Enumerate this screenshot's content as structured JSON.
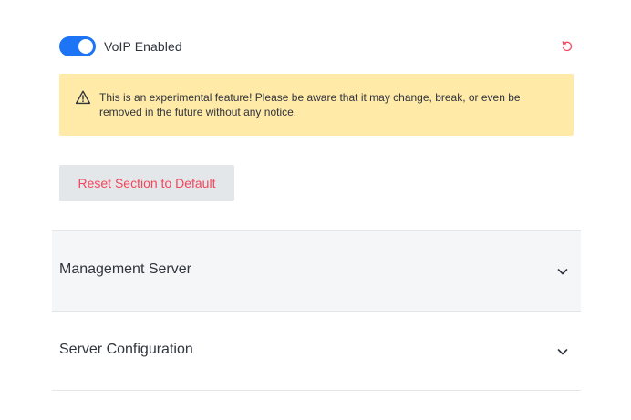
{
  "voip_toggle": {
    "label": "VoIP Enabled",
    "enabled": true,
    "accent_color": "#1d74f5",
    "reset_icon": "reset-icon"
  },
  "warning": {
    "icon": "warning-triangle-icon",
    "text": "This is an experimental feature! Please be aware that it may change, break, or even be removed in the future without any notice.",
    "background": "#ffeaa8"
  },
  "reset_section_button": {
    "label": "Reset Section to Default",
    "color": "#f5455c"
  },
  "sections": [
    {
      "title": "Management Server",
      "icon": "chevron-down-icon"
    },
    {
      "title": "Server Configuration",
      "icon": "chevron-down-icon"
    }
  ]
}
